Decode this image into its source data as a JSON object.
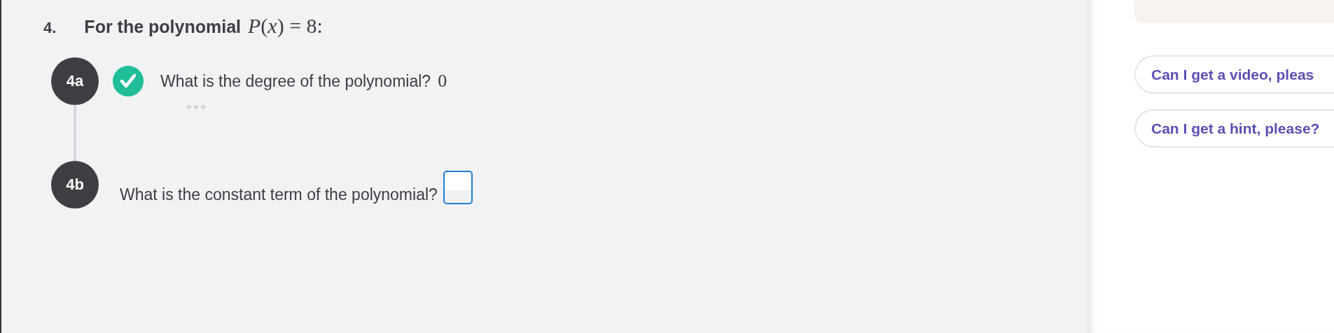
{
  "question": {
    "number": "4.",
    "prompt": "For the polynomial",
    "formula": "*P*(*x*) = 8:"
  },
  "parts": [
    {
      "label": "4a",
      "kind": "answered",
      "correct": true,
      "text": "What is the degree of the polynomial?",
      "answer": "0"
    },
    {
      "label": "4b",
      "kind": "input",
      "text": "What is the constant term of the polynomial?"
    }
  ],
  "chat": {
    "suggestions": [
      "Can I get a video, pleas",
      "Can I get a hint, please?"
    ]
  }
}
